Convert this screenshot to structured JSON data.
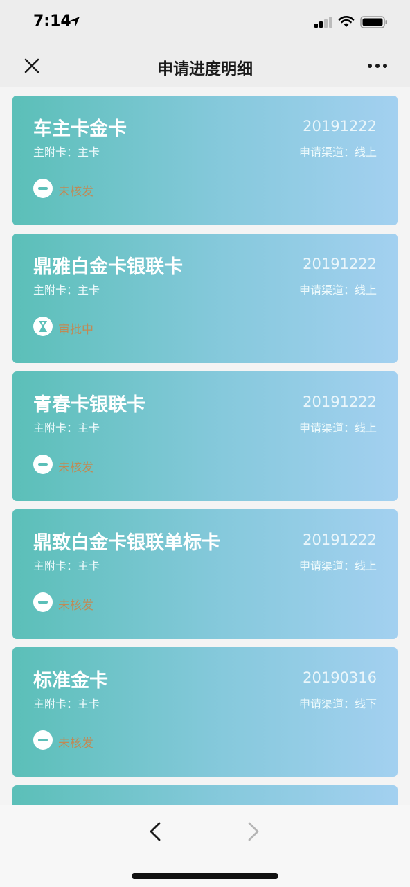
{
  "status_bar": {
    "time": "7:14"
  },
  "nav": {
    "title": "申请进度明细"
  },
  "cards": [
    {
      "name": "车主卡金卡",
      "date": "20191222",
      "card_type": "主附卡：主卡",
      "channel": "申请渠道：线上",
      "status": "未核发",
      "status_icon": "minus-circle-icon"
    },
    {
      "name": "鼎雅白金卡银联卡",
      "date": "20191222",
      "card_type": "主附卡：主卡",
      "channel": "申请渠道：线上",
      "status": "审批中",
      "status_icon": "hourglass-icon"
    },
    {
      "name": "青春卡银联卡",
      "date": "20191222",
      "card_type": "主附卡：主卡",
      "channel": "申请渠道：线上",
      "status": "未核发",
      "status_icon": "minus-circle-icon"
    },
    {
      "name": "鼎致白金卡银联单标卡",
      "date": "20191222",
      "card_type": "主附卡：主卡",
      "channel": "申请渠道：线上",
      "status": "未核发",
      "status_icon": "minus-circle-icon"
    },
    {
      "name": "标准金卡",
      "date": "20190316",
      "card_type": "主附卡：主卡",
      "channel": "申请渠道：线下",
      "status": "未核发",
      "status_icon": "minus-circle-icon"
    }
  ],
  "colors": {
    "card_gradient_start": "#5bbfb8",
    "card_gradient_end": "#a3d0f0",
    "status_text": "#c08a55",
    "icon_accent": "#5bbfb8"
  }
}
